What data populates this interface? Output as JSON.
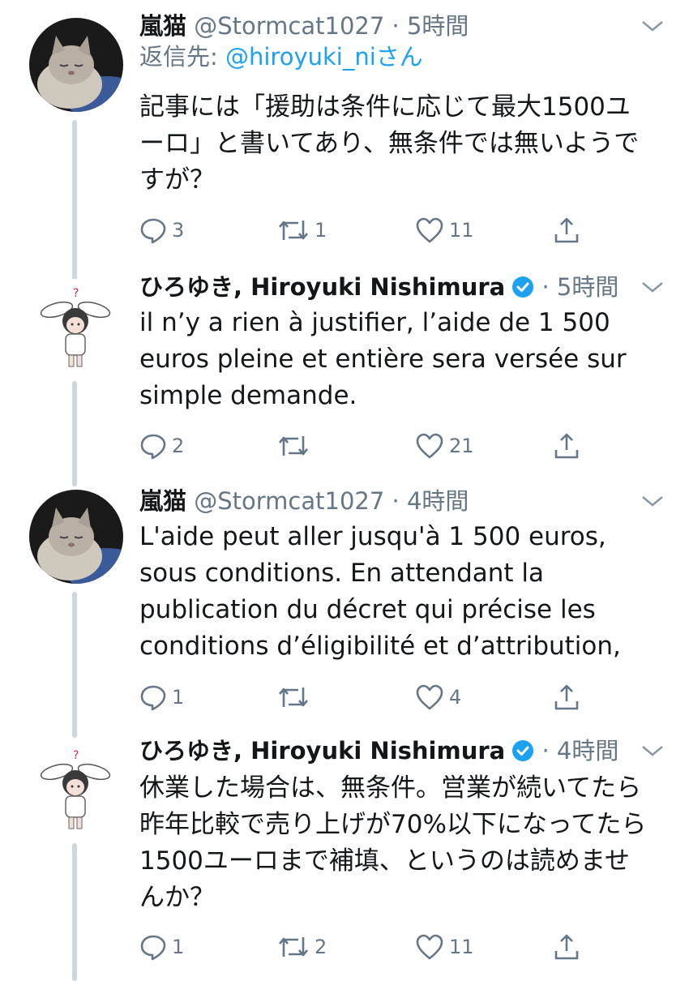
{
  "tweets": [
    {
      "name": "嵐猫",
      "handle": "@Stormcat1027",
      "time": "5時間",
      "reply_to_prefix": "返信先: ",
      "reply_to_handle": "@hiroyuki_ni",
      "reply_to_suffix": "さん",
      "lines": [
        "記事には「援助は条件に応じて最大1500ユ",
        "ーロ」と書いてあり、無条件では無いようで",
        "すが？"
      ],
      "replies": "3",
      "retweets": "1",
      "likes": "11",
      "verified": false
    },
    {
      "name": "ひろゆき, Hiroyuki Nishimura",
      "handle": "",
      "time": "5時間",
      "lines": [
        "il n’y a rien à justifier, l’aide de 1 500",
        "euros pleine et entière sera versée sur",
        "simple demande."
      ],
      "replies": "2",
      "retweets": "",
      "likes": "21",
      "verified": true
    },
    {
      "name": "嵐猫",
      "handle": "@Stormcat1027",
      "time": "4時間",
      "lines": [
        "L'aide peut aller jusqu'à 1 500 euros,",
        "sous conditions. En attendant la",
        "publication du décret qui précise les",
        "conditions d’éligibilité et d’attribution,"
      ],
      "replies": "1",
      "retweets": "",
      "likes": "4",
      "verified": false
    },
    {
      "name": "ひろゆき, Hiroyuki Nishimura",
      "handle": "",
      "time": "4時間",
      "lines": [
        "休業した場合は、無条件。営業が続いてたら",
        "昨年比較で売り上げが70%以下になってたら",
        "1500ユーロまで補填、というのは読めませ",
        "んか？"
      ],
      "replies": "1",
      "retweets": "2",
      "likes": "11",
      "verified": true
    }
  ],
  "separator": "·",
  "colors": {
    "accent": "#1da1f2",
    "muted": "#657786",
    "text": "#14171a",
    "line": "#ccd6dd"
  },
  "icons": [
    "reply-icon",
    "retweet-icon",
    "like-icon",
    "share-icon",
    "chevron-down-icon",
    "verified-badge-icon",
    "cat-avatar",
    "bunny-avatar"
  ]
}
